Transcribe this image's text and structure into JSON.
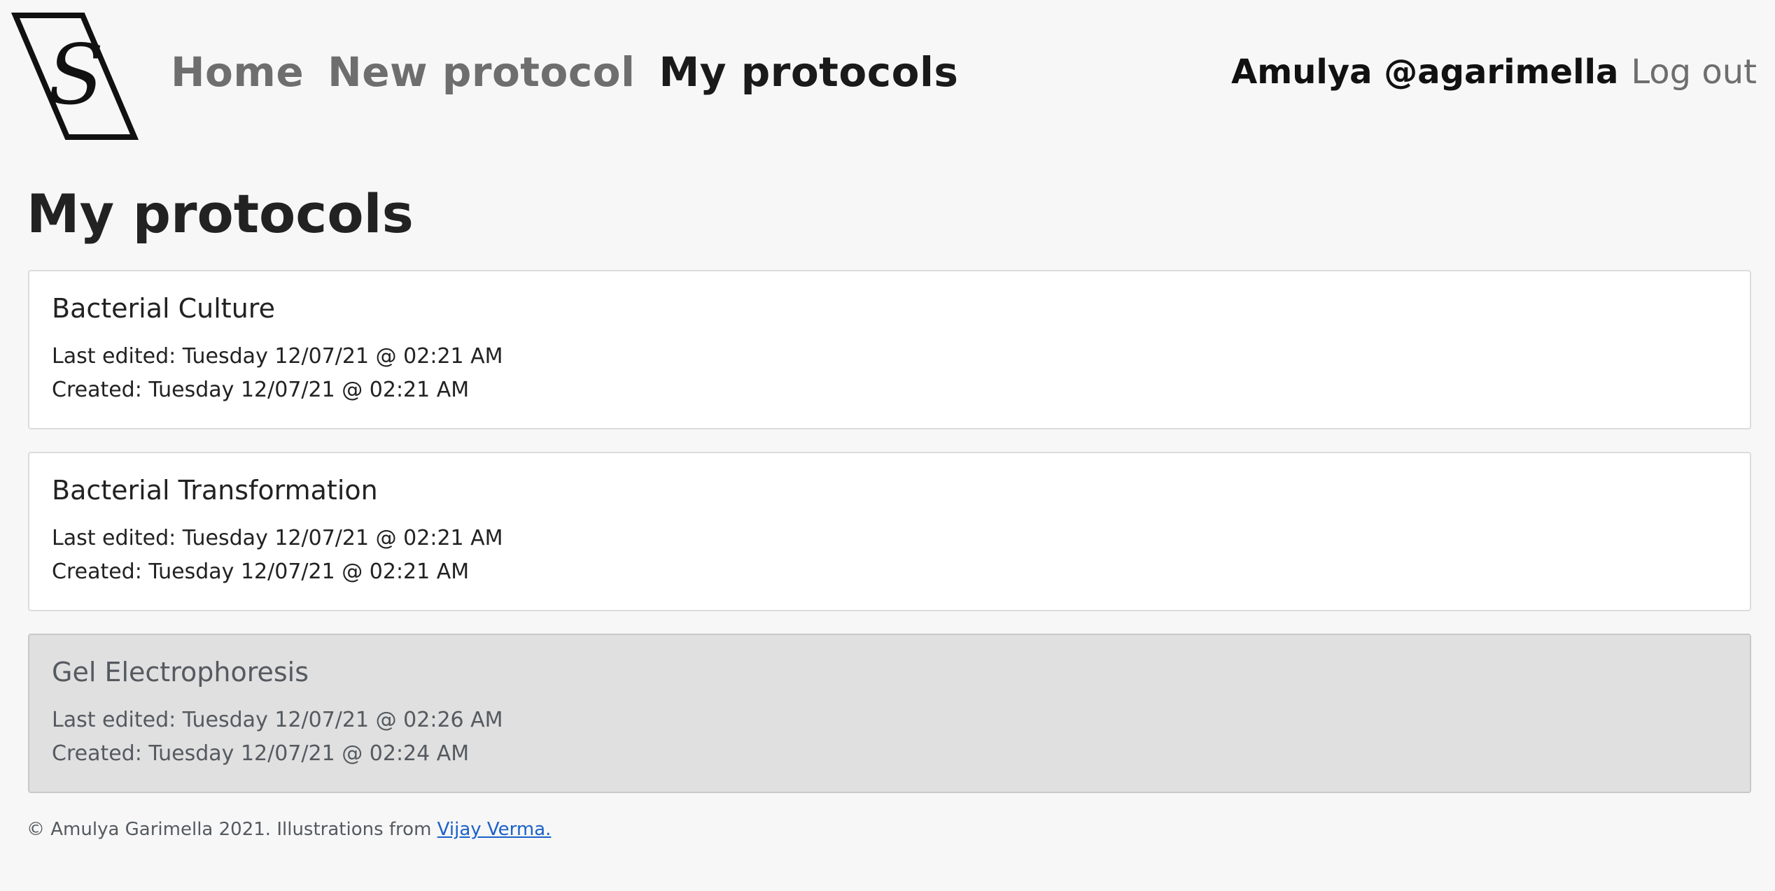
{
  "header": {
    "logo_letter": "S",
    "nav": [
      {
        "label": "Home",
        "active": false
      },
      {
        "label": "New protocol",
        "active": false
      },
      {
        "label": "My protocols",
        "active": true
      }
    ],
    "user_display": "Amulya @agarimella",
    "logout_label": "Log out"
  },
  "main": {
    "title": "My protocols",
    "protocols": [
      {
        "name": "Bacterial Culture",
        "last_edited": "Last edited: Tuesday 12/07/21 @ 02:21 AM",
        "created": "Created: Tuesday 12/07/21 @ 02:21 AM",
        "hovered": false
      },
      {
        "name": "Bacterial Transformation",
        "last_edited": "Last edited: Tuesday 12/07/21 @ 02:21 AM",
        "created": "Created: Tuesday 12/07/21 @ 02:21 AM",
        "hovered": false
      },
      {
        "name": "Gel Electrophoresis",
        "last_edited": "Last edited: Tuesday 12/07/21 @ 02:26 AM",
        "created": "Created: Tuesday 12/07/21 @ 02:24 AM",
        "hovered": true
      }
    ]
  },
  "footer": {
    "text": "© Amulya Garimella 2021. Illustrations from ",
    "link_label": "Vijay Verma."
  },
  "colors": {
    "background": "#f7f7f7",
    "card": "#ffffff",
    "card_hover": "#e0e0e0",
    "nav_inactive": "#6e6e6e",
    "nav_active": "#1a1a1a",
    "link": "#1a62c9"
  }
}
